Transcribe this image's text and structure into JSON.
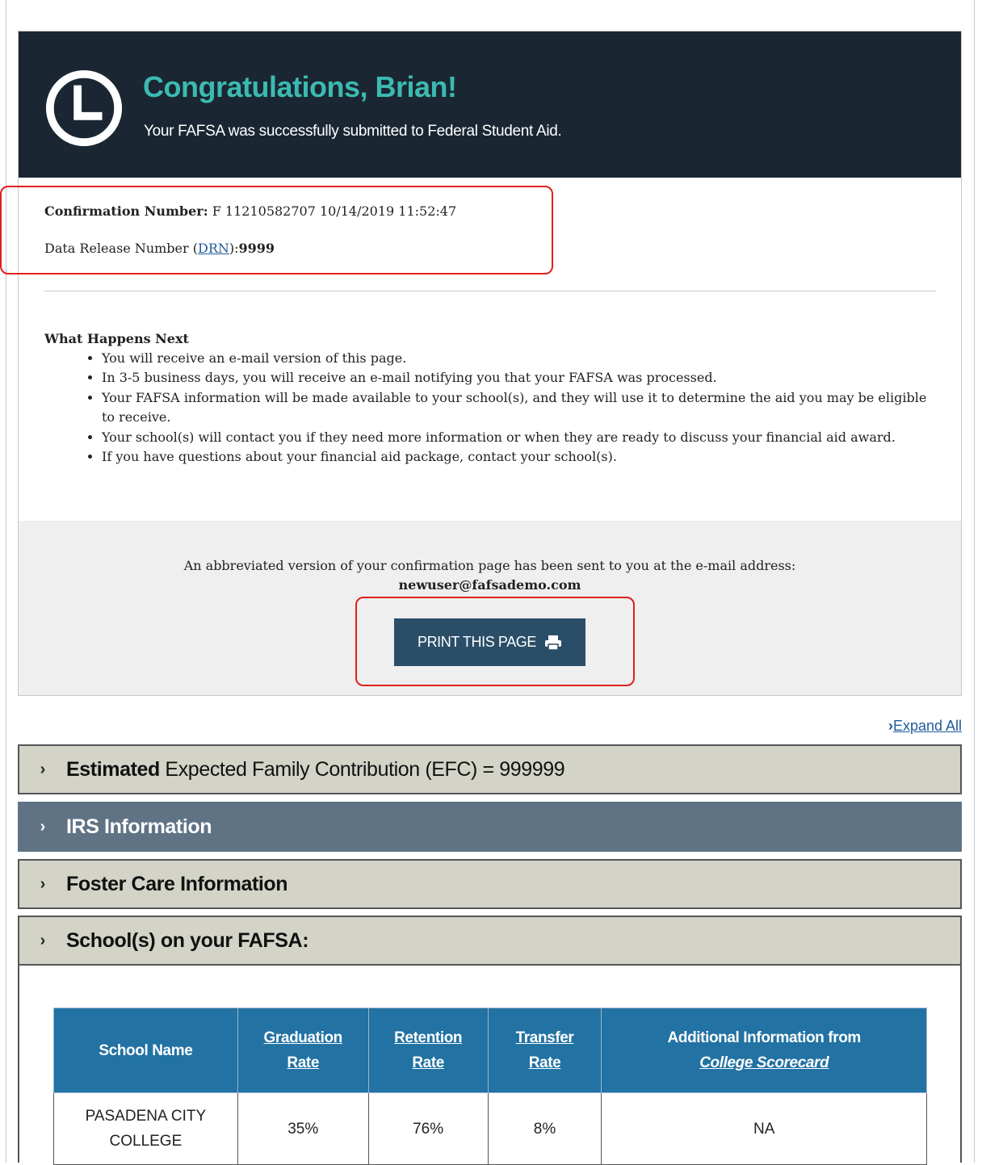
{
  "hero": {
    "title": "Congratulations, Brian!",
    "subtitle": "Your FAFSA was successfully submitted to Federal Student Aid."
  },
  "confirmation": {
    "label": "Confirmation Number:",
    "value": " F 11210582707 10/14/2019 11:52:47",
    "drn_prefix": "Data Release Number (",
    "drn_link": "DRN",
    "drn_suffix": "):",
    "drn_value": "9999"
  },
  "next": {
    "title": "What Happens Next",
    "items": [
      "You will receive an e-mail version of this page.",
      "In 3-5 business days, you will receive an e-mail notifying you that your FAFSA was processed.",
      "Your FAFSA information will be made available to your school(s), and they will use it to determine the aid you may be eligible to receive.",
      "Your school(s) will contact you if they need more information or when they are ready to discuss your financial aid award.",
      "If you have questions about your financial aid package, contact your school(s)."
    ]
  },
  "email": {
    "text": "An abbreviated version of your confirmation page has been sent to you at the e-mail address:",
    "address": "newuser@fafsademo.com"
  },
  "print_button": {
    "label": "PRINT THIS PAGE"
  },
  "expand_all": "Expand All",
  "accordions": {
    "efc_bold": "Estimated",
    "efc_rest": " Expected Family Contribution (EFC) = 999999",
    "irs": "IRS Information",
    "foster": "Foster Care Information",
    "schools": "School(s) on your FAFSA:"
  },
  "schools_table": {
    "headers": {
      "name": "School Name",
      "grad_1": "Graduation",
      "grad_2": "Rate",
      "ret_1": "Retention",
      "ret_2": "Rate",
      "trans_1": "Transfer",
      "trans_2": "Rate",
      "addl_1": "Additional Information from",
      "addl_2": "College Scorecard"
    },
    "rows": [
      {
        "name_1": "PASADENA CITY",
        "name_2": "COLLEGE",
        "grad": "35%",
        "ret": "76%",
        "trans": "8%",
        "addl": "NA"
      }
    ]
  },
  "colors": {
    "hero_bg": "#1a2732",
    "hero_title": "#3cbab2",
    "button_bg": "#2b4e68",
    "highlight": "#e0201f",
    "table_header": "#2272a3",
    "accordion_active": "#5f7385",
    "accordion": "#d3d3c8"
  },
  "icons": {
    "hero": "clock-icon",
    "print": "printer-icon",
    "accordion": "chevron-right-icon"
  }
}
